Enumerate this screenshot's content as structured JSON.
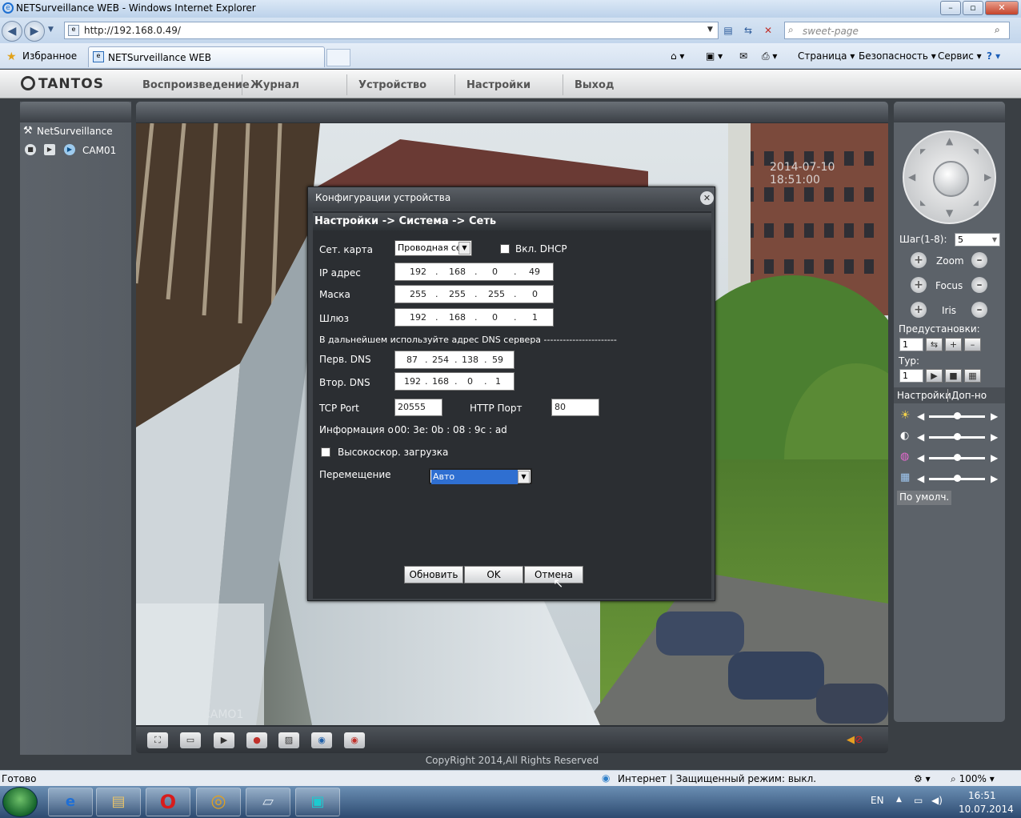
{
  "window": {
    "title": "NETSurveillance WEB - Windows Internet Explorer"
  },
  "address": {
    "url": "http://192.168.0.49/",
    "search_placeholder": "sweet-page"
  },
  "favbar": {
    "favorites_label": "Избранное",
    "tab_title": "NETSurveillance WEB",
    "commands": [
      "Страница ▾",
      "Безопасность ▾",
      "Сервис ▾"
    ]
  },
  "app": {
    "logo": "TANTOS",
    "menu": [
      "Воспроизведение",
      "Журнал",
      "Устройство",
      "Настройки",
      "Выход"
    ],
    "tree_root": "NetSurveillance",
    "camera": "CAM01",
    "video_timestamp": "2014-07-10 18:51:00",
    "video_label": "CAMO1",
    "copyright": "CopyRight 2014,All Rights Reserved"
  },
  "ptz": {
    "step_label": "Шаг(1-8):",
    "step_value": "5",
    "zoom": "Zoom",
    "focus": "Focus",
    "iris": "Iris",
    "presets_label": "Предустановки:",
    "preset_value": "1",
    "tour_label": "Тур:",
    "tour_value": "1",
    "tab_settings": "Настройки",
    "tab_extra": "Доп-но",
    "default_button": "По умолч.",
    "sliders": [
      0.5,
      0.5,
      0.5,
      0.5
    ]
  },
  "dialog": {
    "title": "Конфигурации устройства",
    "breadcrumb": "Настройки -> Система -> Сеть",
    "net_card_label": "Сет. карта",
    "net_card_value": "Проводная сет",
    "dhcp_label": "Вкл. DHCP",
    "ip_label": "IP адрес",
    "ip": [
      "192",
      "168",
      "0",
      "49"
    ],
    "mask_label": "Маска",
    "mask": [
      "255",
      "255",
      "255",
      "0"
    ],
    "gateway_label": "Шлюз",
    "gateway": [
      "192",
      "168",
      "0",
      "1"
    ],
    "dns_note": "В дальнейшем используйте адрес DNS сервера -----------------------",
    "dns1_label": "Перв. DNS",
    "dns1": [
      "87",
      "254",
      "138",
      "59"
    ],
    "dns2_label": "Втор. DNS",
    "dns2": [
      "192",
      "168",
      "0",
      "1"
    ],
    "tcp_label": "TCP Port",
    "tcp_value": "20555",
    "http_label": "HTTP Порт",
    "http_value": "80",
    "info_label": "Информация о",
    "mac": [
      "00",
      "3e",
      "0b",
      "08",
      "9c",
      "ad"
    ],
    "highspeed_label": "Высокоскор. загрузка",
    "transfer_label": "Перемещение",
    "transfer_value": "Авто",
    "btn_refresh": "Обновить",
    "btn_ok": "OK",
    "btn_cancel": "Отмена"
  },
  "status": {
    "left": "Готово",
    "zone": "Интернет | Защищенный режим: выкл.",
    "zoom": "100%"
  },
  "taskbar": {
    "lang": "EN",
    "time": "16:51",
    "date": "10.07.2014"
  }
}
